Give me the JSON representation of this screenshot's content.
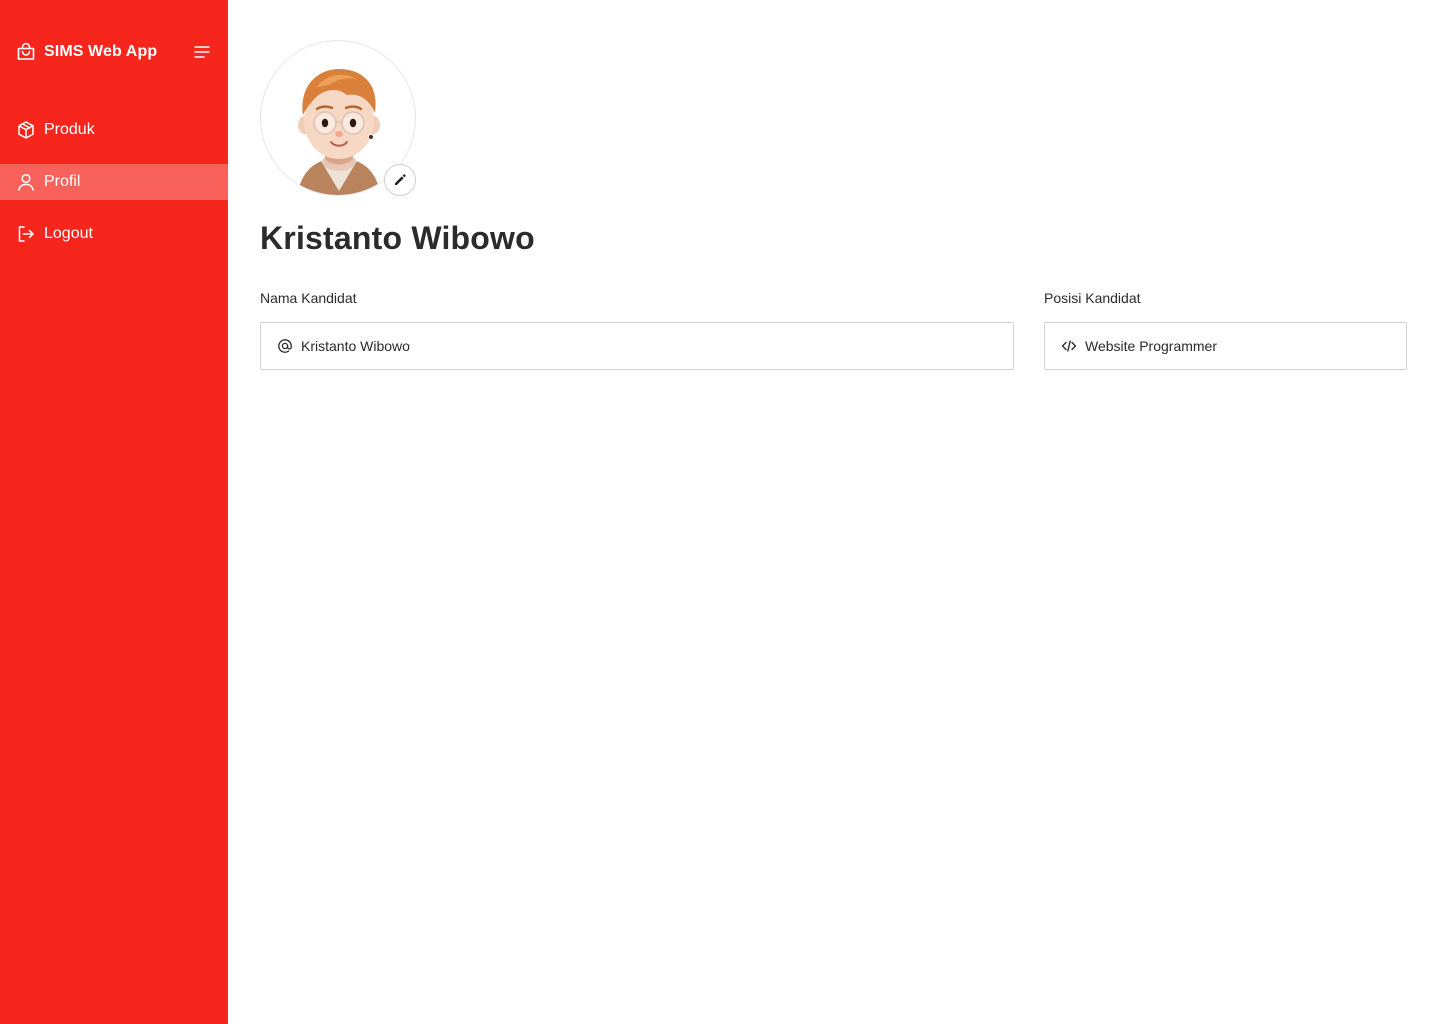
{
  "app": {
    "title": "SIMS Web App"
  },
  "sidebar": {
    "items": [
      {
        "label": "Produk",
        "icon": "box-icon",
        "active": false
      },
      {
        "label": "Profil",
        "icon": "user-icon",
        "active": true
      },
      {
        "label": "Logout",
        "icon": "logout-icon",
        "active": false
      }
    ]
  },
  "profile": {
    "name": "Kristanto Wibowo",
    "fields": {
      "name": {
        "label": "Nama Kandidat",
        "value": "Kristanto Wibowo",
        "icon": "at-icon"
      },
      "position": {
        "label": "Posisi Kandidat",
        "value": "Website Programmer",
        "icon": "code-icon"
      }
    }
  },
  "colors": {
    "sidebar": "#f7261d",
    "sidebar_active": "#f9625b"
  }
}
